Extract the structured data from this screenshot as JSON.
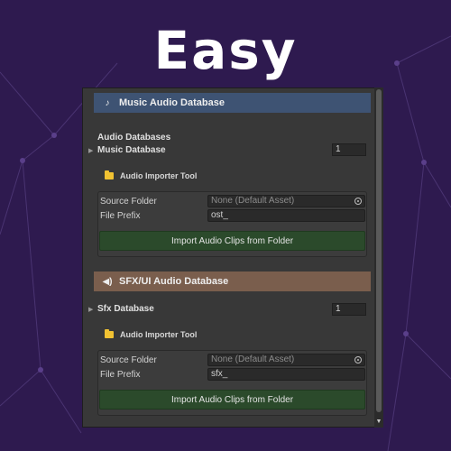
{
  "page_title": "Easy",
  "colors": {
    "background": "#2e1a4f",
    "music_header": "#3e5373",
    "sfx_header": "#7a5e4d",
    "import_button": "#2b4a2b",
    "folder_icon": "#f1c232"
  },
  "music": {
    "header_icon": "music-note-icon",
    "header_label": "Music Audio Database",
    "list_heading": "Audio Databases",
    "database_label": "Music Database",
    "database_count": "1",
    "tool_label": "Audio Importer Tool",
    "source_folder_label": "Source Folder",
    "source_folder_value": "None (Default Asset)",
    "file_prefix_label": "File Prefix",
    "file_prefix_value": "ost_",
    "import_button_label": "Import Audio Clips from Folder"
  },
  "sfx": {
    "header_icon": "speaker-icon",
    "header_label": "SFX/UI Audio Database",
    "database_label": "Sfx Database",
    "database_count": "1",
    "tool_label": "Audio Importer Tool",
    "source_folder_label": "Source Folder",
    "source_folder_value": "None (Default Asset)",
    "file_prefix_label": "File Prefix",
    "file_prefix_value": "sfx_",
    "import_button_label": "Import Audio Clips from Folder"
  }
}
